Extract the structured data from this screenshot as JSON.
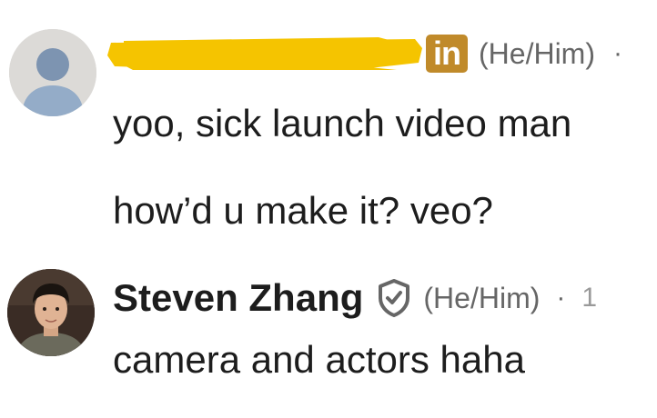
{
  "comments": [
    {
      "author_name_redacted": true,
      "badge": "in",
      "pronouns": "(He/Him)",
      "separator": "·",
      "lines": [
        "yoo, sick launch video man",
        "how’d u make it? veo?"
      ],
      "avatar": "default-avatar-icon"
    },
    {
      "author_name": "Steven Zhang",
      "verified_icon": "shield-check-icon",
      "pronouns": "(He/Him)",
      "separator": "·",
      "trailing": "1",
      "lines": [
        "camera and actors haha"
      ],
      "avatar": "profile-photo"
    }
  ],
  "colors": {
    "redaction": "#f5c400",
    "badge": "#c08a2a",
    "text": "#1d1d1d",
    "muted": "#666666"
  }
}
